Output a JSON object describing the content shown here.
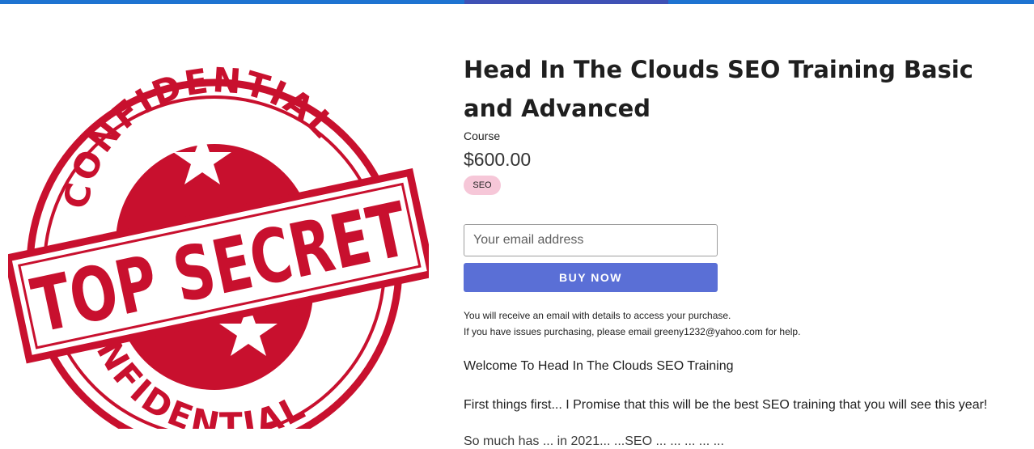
{
  "product": {
    "title": "Head In The Clouds SEO Training Basic and Advanced",
    "type": "Course",
    "price": "$600.00",
    "tag": "SEO"
  },
  "image": {
    "icon": "top-secret-confidential-stamp",
    "stamp_text_top": "CONFIDENTIAL",
    "stamp_text_middle": "TOP SECRET",
    "stamp_text_bottom": "CONFIDENTIAL",
    "stamp_color": "#c8102e"
  },
  "checkout": {
    "email_placeholder": "Your email address",
    "email_value": "",
    "buy_label": "BUY NOW"
  },
  "notice": {
    "line1": "You will receive an email with details to access your purchase.",
    "line2": "If you have issues purchasing, please email greeny1232@yahoo.com for help."
  },
  "description": {
    "p1": "Welcome To Head In The Clouds SEO Training",
    "p2": "First things first... I Promise that this will be the best SEO training that you will see this year!",
    "p3": "So much has ... in 2021... ...SEO ... ... ... ... ..."
  },
  "colors": {
    "topbar": "#1e73d1",
    "topbar_accent": "#3f51b5",
    "buy_button": "#5a6fd6",
    "tag_bg": "#f6c7d8"
  }
}
